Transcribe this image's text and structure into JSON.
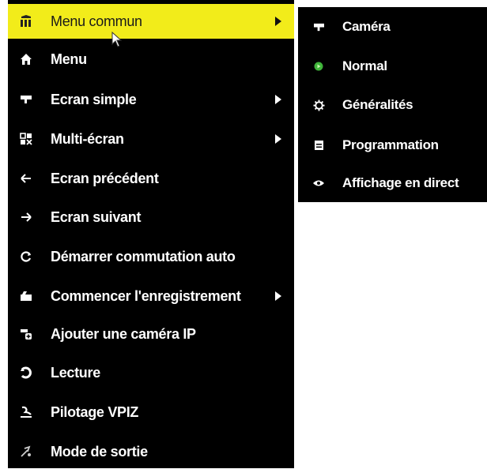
{
  "main_menu": {
    "items": [
      {
        "label": "Menu commun",
        "icon": "grid-icon",
        "submenu": true,
        "active": true
      },
      {
        "label": "Menu",
        "icon": "home-icon",
        "submenu": false
      },
      {
        "label": "Ecran simple",
        "icon": "camera-icon",
        "submenu": true
      },
      {
        "label": "Multi-écran",
        "icon": "multiscreen-icon",
        "submenu": true
      },
      {
        "label": "Ecran précédent",
        "icon": "arrow-left-icon",
        "submenu": false
      },
      {
        "label": "Ecran suivant",
        "icon": "arrow-right-icon",
        "submenu": false
      },
      {
        "label": "Démarrer commutation auto",
        "icon": "refresh-icon",
        "submenu": false
      },
      {
        "label": "Commencer l'enregistrement",
        "icon": "record-icon",
        "submenu": true
      },
      {
        "label": "Ajouter une caméra IP",
        "icon": "add-camera-icon",
        "submenu": false
      },
      {
        "label": "Lecture",
        "icon": "playback-icon",
        "submenu": false
      },
      {
        "label": "Pilotage VPIZ",
        "icon": "ptz-icon",
        "submenu": false
      },
      {
        "label": "Mode de sortie",
        "icon": "output-icon",
        "submenu": false
      }
    ]
  },
  "sub_menu": {
    "items": [
      {
        "label": "Caméra",
        "icon": "camera-icon"
      },
      {
        "label": "Normal",
        "icon": "green-dot-icon"
      },
      {
        "label": "Généralités",
        "icon": "gear-icon"
      },
      {
        "label": "Programmation",
        "icon": "calendar-icon"
      },
      {
        "label": "Affichage en direct",
        "icon": "eye-icon"
      }
    ]
  },
  "colors": {
    "menu_bg": "#000000",
    "highlight": "#f2ec1a",
    "text": "#ffffff",
    "normal_dot": "#3fb43a"
  }
}
